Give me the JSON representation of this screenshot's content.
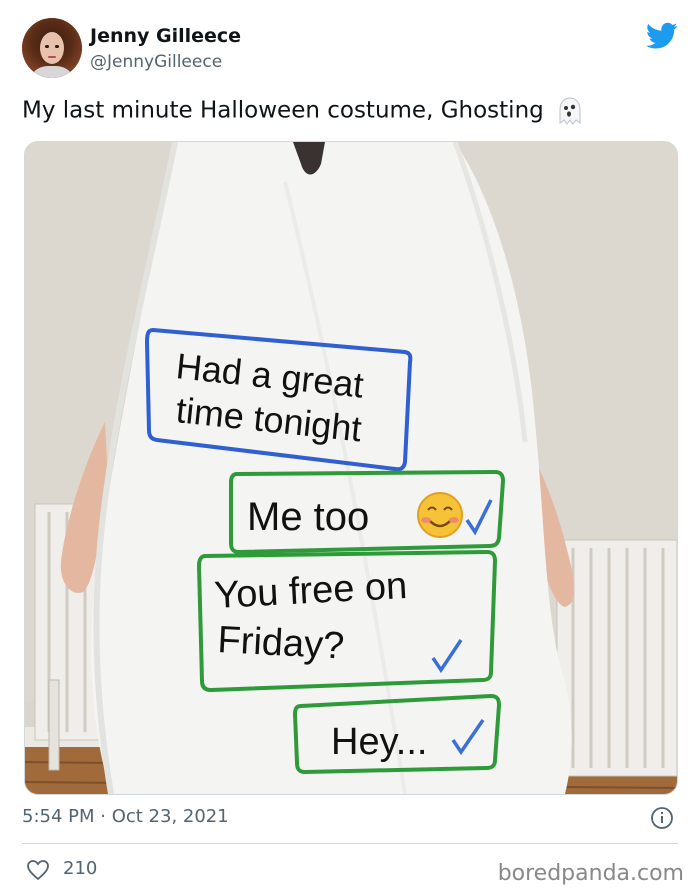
{
  "tweet": {
    "author_name": "Jenny Gilleece",
    "author_handle": "@JennyGilleece",
    "text": "My last minute Halloween costume, Ghosting",
    "emoji": "ghost-emoji",
    "timestamp": "5:54 PM · Oct 23, 2021",
    "likes": "210"
  },
  "photo": {
    "bubbles": [
      {
        "line1": "Had a great",
        "line2": "time tonight",
        "border_color": "#2f5fd0"
      },
      {
        "line1": "Me too",
        "border_color": "#2f9a3a"
      },
      {
        "line1": "You free on",
        "line2": "Friday?",
        "border_color": "#2f9a3a"
      },
      {
        "line1": "Hey...",
        "border_color": "#2f9a3a"
      }
    ],
    "check_color": "#3a6fd8"
  },
  "watermark": "boredpanda.com",
  "colors": {
    "twitter_blue": "#1d9bf0",
    "secondary_text": "#536471",
    "divider": "#cfd9de"
  }
}
